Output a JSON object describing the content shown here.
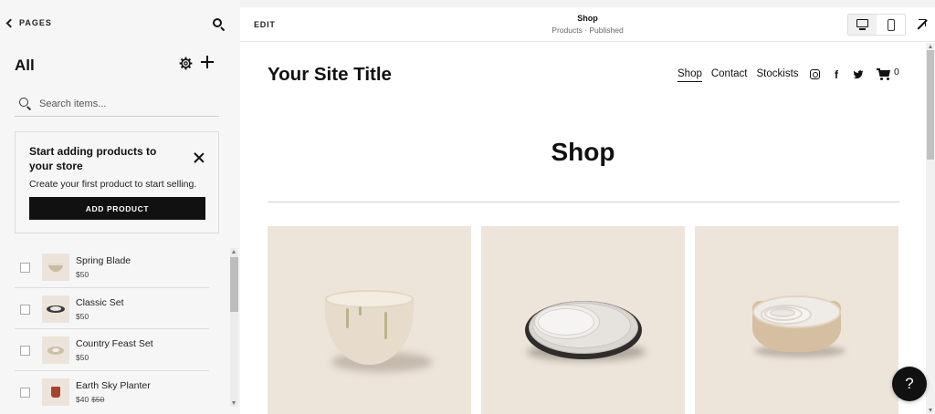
{
  "left_panel": {
    "back_label": "PAGES",
    "section_title": "All",
    "search_placeholder": "Search items...",
    "promo": {
      "title": "Start adding products to your store",
      "text": "Create your first product to start selling.",
      "button_label": "ADD PRODUCT"
    },
    "items": [
      {
        "name": "Spring Blade",
        "price": "$50",
        "old_price": "",
        "thumb_icon": "bowl-thumbnail"
      },
      {
        "name": "Classic Set",
        "price": "$50",
        "old_price": "",
        "thumb_icon": "plates-thumbnail"
      },
      {
        "name": "Country Feast Set",
        "price": "$50",
        "old_price": "",
        "thumb_icon": "bowl-set-thumbnail"
      },
      {
        "name": "Earth Sky Planter",
        "price": "$40",
        "old_price": "$50",
        "thumb_icon": "planter-thumbnail"
      }
    ]
  },
  "preview": {
    "edit_label": "EDIT",
    "page_title": "Shop",
    "page_status": "Products · Published",
    "site": {
      "title": "Your Site Title",
      "nav": [
        "Shop",
        "Contact",
        "Stockists"
      ],
      "active_nav": "Shop",
      "social_icons": [
        "instagram-icon",
        "facebook-icon",
        "twitter-icon"
      ],
      "facebook_glyph": "f",
      "cart_count": "0",
      "heading": "Shop",
      "product_images": [
        "ceramic-bowl",
        "stacked-plates",
        "nesting-bowls"
      ]
    }
  },
  "help_label": "?",
  "colors": {
    "panel_bg": "#f6f6f6",
    "button_black": "#111111",
    "product_bg": "#ede4da"
  }
}
